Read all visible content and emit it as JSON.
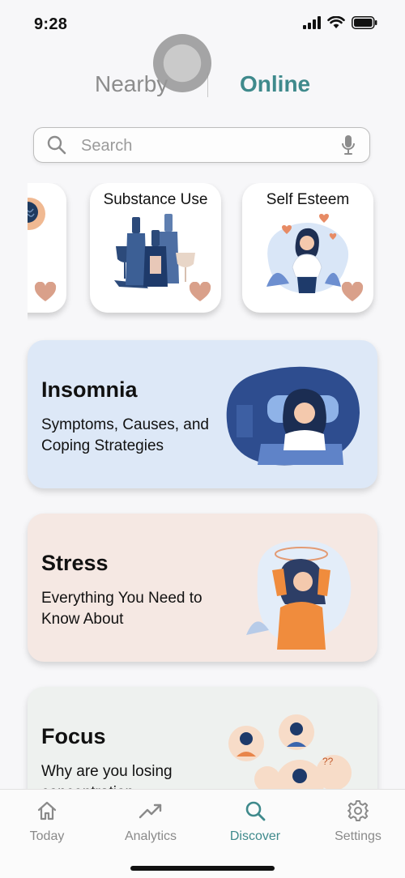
{
  "status": {
    "time": "9:28"
  },
  "segments": {
    "nearby": "Nearby",
    "online": "Online"
  },
  "search": {
    "placeholder": "Search",
    "value": ""
  },
  "topics": [
    {
      "title": "",
      "favorited": true
    },
    {
      "title": "Substance Use",
      "favorited": true
    },
    {
      "title": "Self Esteem",
      "favorited": true
    }
  ],
  "features": [
    {
      "title": "Insomnia",
      "subtitle": "Symptoms, Causes, and Coping Strategies",
      "bg": "#dde8f7"
    },
    {
      "title": "Stress",
      "subtitle": "Everything You Need to Know About",
      "bg": "#f5e8e3"
    },
    {
      "title": "Focus",
      "subtitle": "Why are you losing concentration",
      "bg": "#eef1ef"
    }
  ],
  "tabs": [
    {
      "label": "Today",
      "icon": "home-icon",
      "active": false
    },
    {
      "label": "Analytics",
      "icon": "trend-icon",
      "active": false
    },
    {
      "label": "Discover",
      "icon": "search-icon",
      "active": true
    },
    {
      "label": "Settings",
      "icon": "gear-icon",
      "active": false
    }
  ],
  "colors": {
    "accent": "#3f8a8c",
    "inactive": "#8a8a8a",
    "heart": "#d9a08a"
  }
}
